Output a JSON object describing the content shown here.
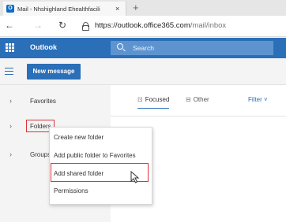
{
  "browser": {
    "tab_title": "Mail - Nhshighland Ehealthfacili",
    "tab_favicon": "O",
    "tab_close": "×",
    "new_tab": "+",
    "back": "←",
    "forward": "→",
    "refresh": "↻",
    "url_host": "https://outlook.office365.com",
    "url_path": "/mail/inbox"
  },
  "header": {
    "app_name": "Outlook",
    "search_placeholder": "Search",
    "brand_color": "#2a6fb8"
  },
  "toolbar": {
    "new_message_label": "New message"
  },
  "nav": {
    "favorites": "Favorites",
    "folders": "Folders",
    "groups": "Groups",
    "chevron": "›"
  },
  "main": {
    "tab_focused": "Focused",
    "tab_other": "Other",
    "filter": "Filter ˅"
  },
  "context_menu": {
    "items": [
      "Create new folder",
      "Add public folder to Favorites",
      "Add shared folder",
      "Permissions"
    ],
    "highlight_color": "#d9343a"
  }
}
